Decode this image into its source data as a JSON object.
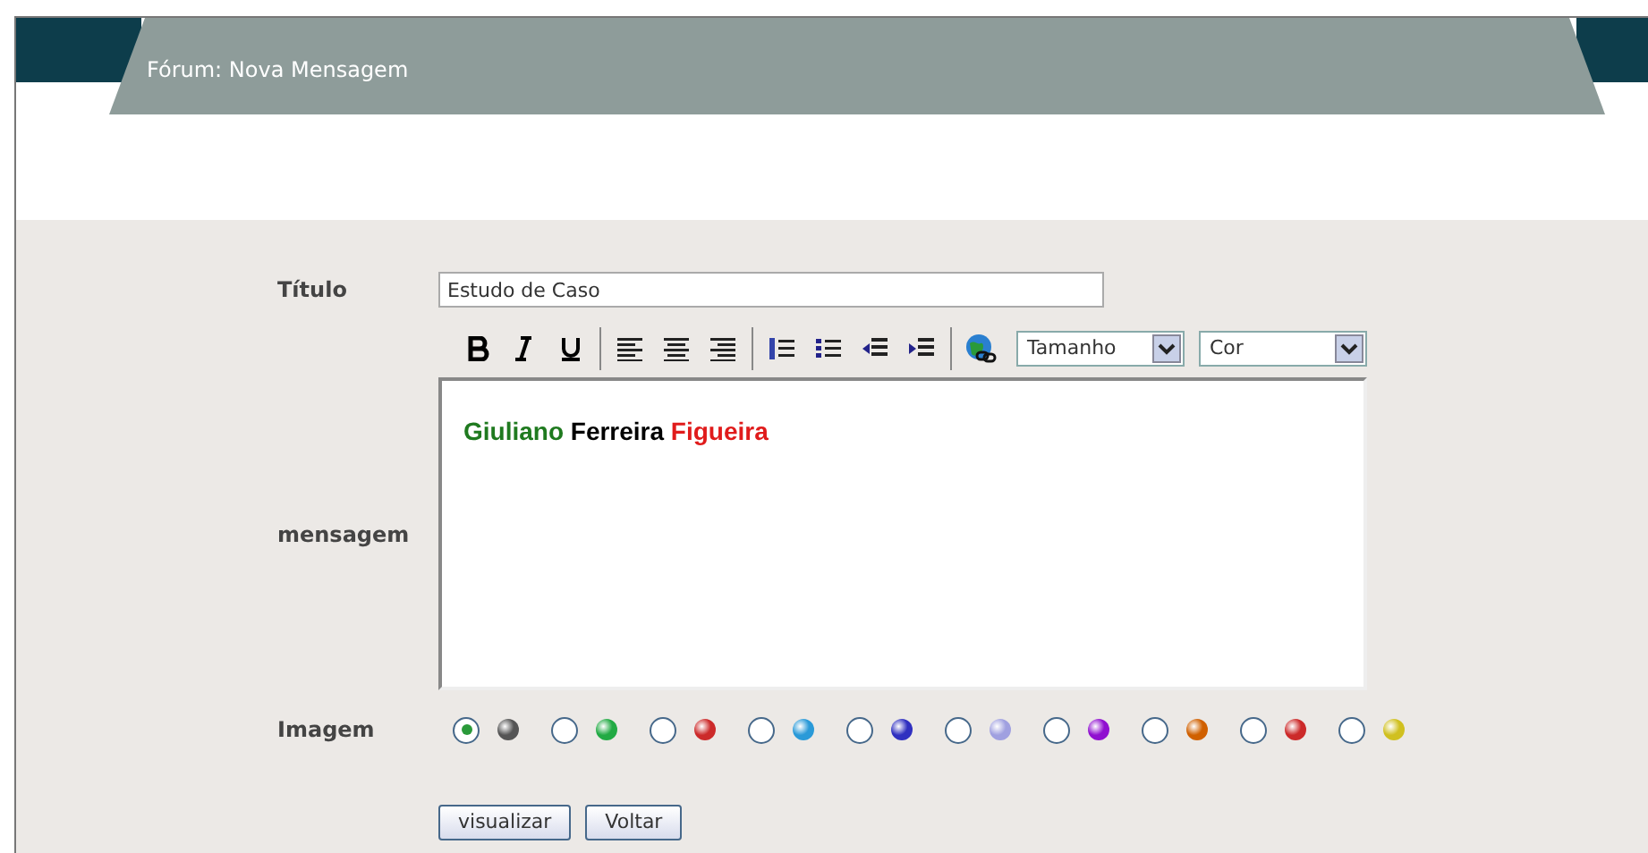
{
  "header": {
    "title": "Fórum: Nova Mensagem"
  },
  "form": {
    "title_label": "Título",
    "title_value": "Estudo de Caso",
    "toolbar": {
      "size_select": "Tamanho",
      "color_select": "Cor"
    },
    "message_label": "mensagem",
    "message_segments": [
      {
        "text": "Giuliano",
        "color": "#1f7a1f"
      },
      {
        "text": "Ferreira",
        "color": "#000000"
      },
      {
        "text": "Figueira",
        "color": "#e01b1b"
      }
    ],
    "image_label": "Imagem",
    "images": [
      {
        "color": "#555555",
        "selected": true
      },
      {
        "color": "#22aa44",
        "selected": false
      },
      {
        "color": "#cc2a2a",
        "selected": false
      },
      {
        "color": "#2a9ad8",
        "selected": false
      },
      {
        "color": "#3030c0",
        "selected": false
      },
      {
        "color": "#a0a0e0",
        "selected": false
      },
      {
        "color": "#9010d0",
        "selected": false
      },
      {
        "color": "#d06000",
        "selected": false
      },
      {
        "color": "#cc2a2a",
        "selected": false
      },
      {
        "color": "#d0c020",
        "selected": false
      }
    ],
    "buttons": [
      "visualizar",
      "Voltar"
    ]
  }
}
